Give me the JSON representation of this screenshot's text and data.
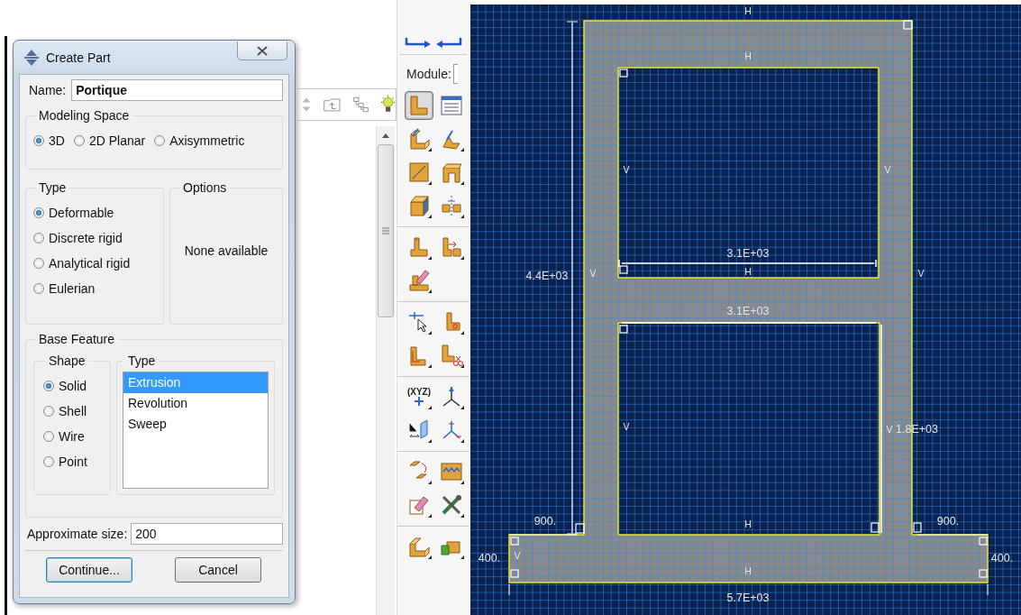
{
  "dialog": {
    "title": "Create Part",
    "name_label": "Name:",
    "name_value": "Portique",
    "modeling_space": {
      "title": "Modeling Space",
      "options": [
        {
          "label": "3D",
          "selected": true
        },
        {
          "label": "2D Planar",
          "selected": false
        },
        {
          "label": "Axisymmetric",
          "selected": false
        }
      ]
    },
    "type": {
      "title": "Type",
      "options": [
        {
          "label": "Deformable",
          "selected": true
        },
        {
          "label": "Discrete rigid",
          "selected": false
        },
        {
          "label": "Analytical rigid",
          "selected": false
        },
        {
          "label": "Eulerian",
          "selected": false
        }
      ]
    },
    "options": {
      "title": "Options",
      "text": "None available"
    },
    "base_feature": {
      "title": "Base Feature",
      "shape": {
        "title": "Shape",
        "options": [
          {
            "label": "Solid",
            "selected": true
          },
          {
            "label": "Shell",
            "selected": false
          },
          {
            "label": "Wire",
            "selected": false
          },
          {
            "label": "Point",
            "selected": false
          }
        ]
      },
      "type": {
        "title": "Type",
        "items": [
          {
            "label": "Extrusion",
            "selected": true
          },
          {
            "label": "Revolution",
            "selected": false
          },
          {
            "label": "Sweep",
            "selected": false
          }
        ]
      }
    },
    "approximate_size": {
      "label": "Approximate size:",
      "value": "200"
    },
    "buttons": [
      {
        "label": "Continue...",
        "default": true
      },
      {
        "label": "Cancel",
        "default": false
      }
    ]
  },
  "toolbox": {
    "module_label": "Module:",
    "tools": [
      {
        "selected": true
      },
      {
        "selected": false
      },
      {
        "selected": false
      },
      {
        "selected": false
      },
      {
        "selected": false
      },
      {
        "selected": false
      },
      {
        "selected": false
      },
      {
        "selected": false
      },
      {
        "selected": false
      },
      {
        "selected": false
      },
      {
        "selected": false
      },
      {
        "selected": false
      },
      {
        "selected": false
      },
      {
        "selected": false
      },
      {
        "selected": false
      },
      {
        "selected": false,
        "text": "(XYZ)"
      },
      {
        "selected": false
      },
      {
        "selected": false
      },
      {
        "selected": false
      },
      {
        "selected": false
      },
      {
        "selected": false
      },
      {
        "selected": false
      },
      {
        "selected": false
      },
      {
        "selected": false
      },
      {
        "selected": false
      }
    ]
  },
  "sketch": {
    "labels": [
      {
        "text": "H",
        "kind": "constraint"
      },
      {
        "text": "H",
        "kind": "constraint"
      },
      {
        "text": "V",
        "kind": "constraint"
      },
      {
        "text": "V",
        "kind": "constraint"
      },
      {
        "text": "3.1E+03",
        "kind": "dimension"
      },
      {
        "text": "4.4E+03",
        "kind": "dimension"
      },
      {
        "text": "V",
        "kind": "constraint"
      },
      {
        "text": "H",
        "kind": "constraint"
      },
      {
        "text": "V",
        "kind": "constraint"
      },
      {
        "text": "3.1E+03",
        "kind": "dimension"
      },
      {
        "text": "V",
        "kind": "constraint"
      },
      {
        "text": "V",
        "kind": "constraint"
      },
      {
        "text": "1.8E+03",
        "kind": "dimension"
      },
      {
        "text": "900.",
        "kind": "dimension"
      },
      {
        "text": "H",
        "kind": "constraint"
      },
      {
        "text": "900.",
        "kind": "dimension"
      },
      {
        "text": "400.",
        "kind": "dimension"
      },
      {
        "text": "V",
        "kind": "constraint"
      },
      {
        "text": "400.",
        "kind": "dimension"
      },
      {
        "text": "H",
        "kind": "constraint"
      },
      {
        "text": "5.7E+03",
        "kind": "dimension"
      }
    ]
  }
}
